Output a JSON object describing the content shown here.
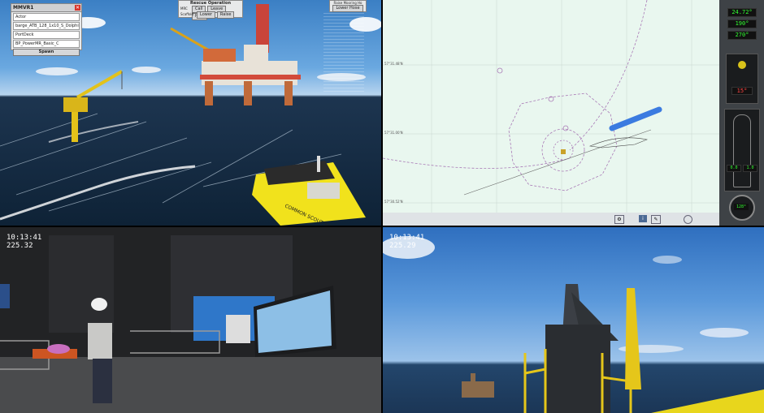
{
  "sim": {
    "title": "MMVR1",
    "dropdowns": [
      "Actor",
      "barge_ATB_128_1x10_S_Dolphin_C_6",
      "PortDeck",
      "BP_PowerMR_Basic_C"
    ],
    "spawn_label": "Spawn",
    "rescue": {
      "title": "Rescue Operation",
      "row1": [
        "Call",
        "Leave",
        "Hide"
      ],
      "row2": [
        "Lower",
        "Raise"
      ],
      "left1": "MRC",
      "left2": "Scaffold"
    },
    "mooring": {
      "title": "Raise Mooring Ho",
      "button": "Lower Hose"
    },
    "boat_text": "COMMON SCOUT SCAVENGERS"
  },
  "nav": {
    "lat_labels": [
      "57°31.48'N",
      "57°31.00'N",
      "57°30.52'N"
    ],
    "readouts": [
      "24.72°",
      "190°",
      "270°",
      "15°",
      "0.0",
      "1.0",
      "128°"
    ],
    "toolbar_icons": [
      "settings-icon",
      "info-icon",
      "edit-icon"
    ]
  },
  "video": {
    "time_left": "10:13:41",
    "frame_left": "225.32",
    "time_right": "10:13:41",
    "frame_right": "225.29"
  }
}
